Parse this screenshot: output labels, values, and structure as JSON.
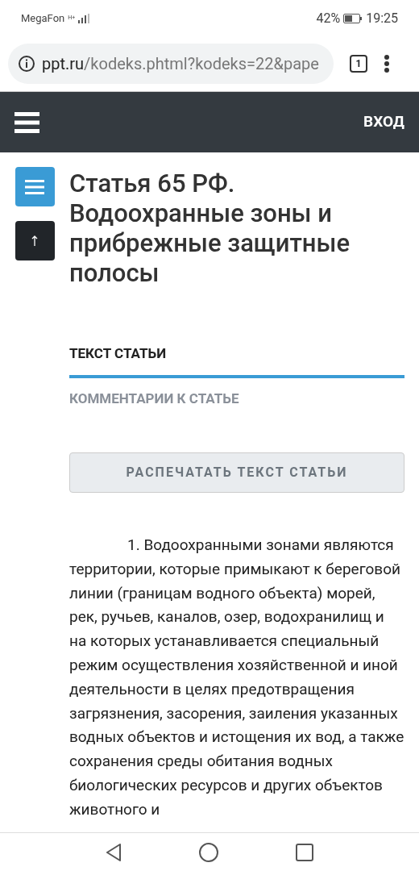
{
  "status_bar": {
    "carrier": "MegaFon",
    "network": "H+",
    "battery": "42%",
    "time": "19:25"
  },
  "browser": {
    "url_host": "ppt.ru",
    "url_path": "/kodeks.phtml?kodeks=22&pape",
    "tab_count": "1"
  },
  "header": {
    "login": "ВХОД"
  },
  "article": {
    "title": "Статья 65 РФ. Водоохранные зоны и прибрежные защитные полосы",
    "tabs": [
      {
        "label": "ТЕКСТ СТАТЬИ",
        "selected": true
      },
      {
        "label": "КОММЕНТАРИИ К СТАТЬЕ",
        "selected": false
      }
    ],
    "print_button": "РАСПЕЧАТАТЬ ТЕКСТ СТАТЬИ",
    "paragraph": "1. Водоохранными зонами являются территории, которые примыкают к береговой линии (границам водного объекта) морей, рек, ручьев, каналов, озер, водохранилищ и на которых устанавливается специальный режим осуществления хозяйственной и иной деятельности в целях предотвращения загрязнения, засорения, заиления указанных водных объектов и истощения их вод, а также сохранения среды обитания водных биологических ресурсов и других объектов животного и"
  }
}
